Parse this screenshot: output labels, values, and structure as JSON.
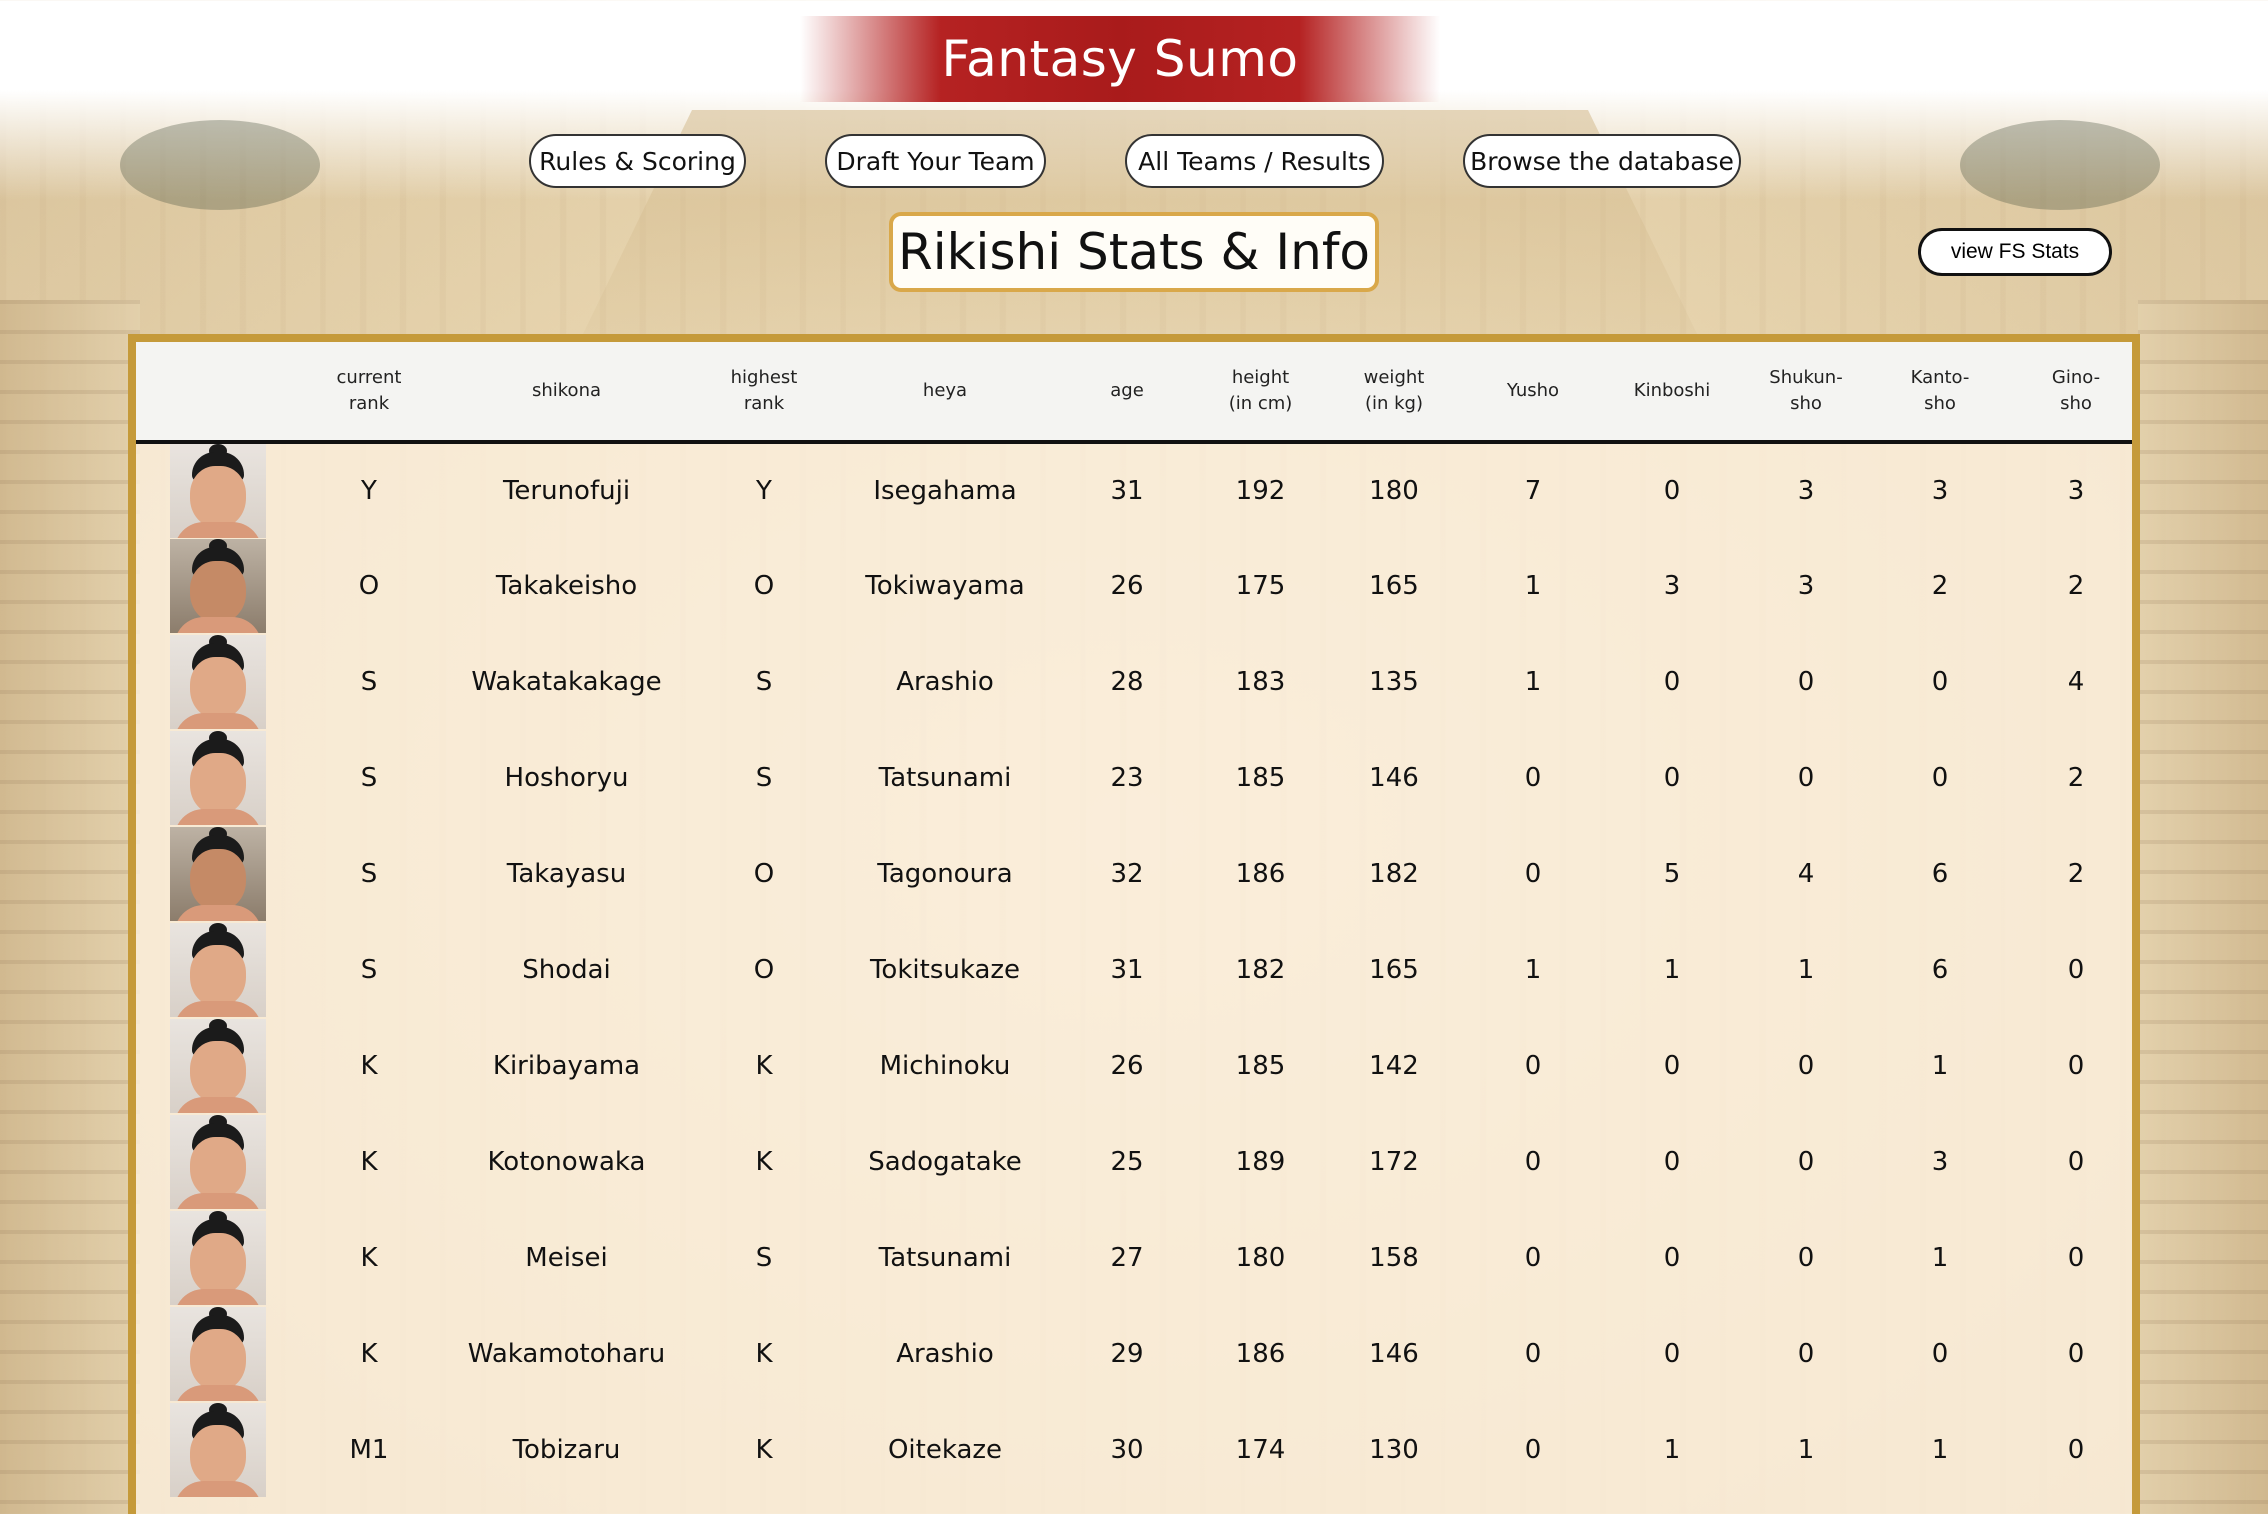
{
  "app": {
    "title": "Fantasy Sumo"
  },
  "nav": {
    "items": [
      {
        "label": "Rules & Scoring"
      },
      {
        "label": "Draft Your Team"
      },
      {
        "label": "All Teams / Results"
      },
      {
        "label": "Browse the database"
      }
    ]
  },
  "page": {
    "title": "Rikishi Stats & Info",
    "fs_stats_label": "view FS Stats"
  },
  "table": {
    "headers": [
      {
        "line1": "current",
        "line2": "rank"
      },
      {
        "line1": "shikona",
        "line2": ""
      },
      {
        "line1": "highest",
        "line2": "rank"
      },
      {
        "line1": "heya",
        "line2": ""
      },
      {
        "line1": "age",
        "line2": ""
      },
      {
        "line1": "height",
        "line2": "(in cm)"
      },
      {
        "line1": "weight",
        "line2": "(in kg)"
      },
      {
        "line1": "Yusho",
        "line2": ""
      },
      {
        "line1": "Kinboshi",
        "line2": ""
      },
      {
        "line1": "Shukun-",
        "line2": "sho"
      },
      {
        "line1": "Kanto-",
        "line2": "sho"
      },
      {
        "line1": "Gino-",
        "line2": "sho"
      }
    ],
    "rows": [
      {
        "rank": "Y",
        "shikona": "Terunofuji",
        "highest": "Y",
        "heya": "Isegahama",
        "age": "31",
        "height": "192",
        "weight": "180",
        "yusho": "7",
        "kinboshi": "0",
        "shukunsho": "3",
        "kantosho": "3",
        "ginosho": "3"
      },
      {
        "rank": "O",
        "shikona": "Takakeisho",
        "highest": "O",
        "heya": "Tokiwayama",
        "age": "26",
        "height": "175",
        "weight": "165",
        "yusho": "1",
        "kinboshi": "3",
        "shukunsho": "3",
        "kantosho": "2",
        "ginosho": "2"
      },
      {
        "rank": "S",
        "shikona": "Wakatakakage",
        "highest": "S",
        "heya": "Arashio",
        "age": "28",
        "height": "183",
        "weight": "135",
        "yusho": "1",
        "kinboshi": "0",
        "shukunsho": "0",
        "kantosho": "0",
        "ginosho": "4"
      },
      {
        "rank": "S",
        "shikona": "Hoshoryu",
        "highest": "S",
        "heya": "Tatsunami",
        "age": "23",
        "height": "185",
        "weight": "146",
        "yusho": "0",
        "kinboshi": "0",
        "shukunsho": "0",
        "kantosho": "0",
        "ginosho": "2"
      },
      {
        "rank": "S",
        "shikona": "Takayasu",
        "highest": "O",
        "heya": "Tagonoura",
        "age": "32",
        "height": "186",
        "weight": "182",
        "yusho": "0",
        "kinboshi": "5",
        "shukunsho": "4",
        "kantosho": "6",
        "ginosho": "2"
      },
      {
        "rank": "S",
        "shikona": "Shodai",
        "highest": "O",
        "heya": "Tokitsukaze",
        "age": "31",
        "height": "182",
        "weight": "165",
        "yusho": "1",
        "kinboshi": "1",
        "shukunsho": "1",
        "kantosho": "6",
        "ginosho": "0"
      },
      {
        "rank": "K",
        "shikona": "Kiribayama",
        "highest": "K",
        "heya": "Michinoku",
        "age": "26",
        "height": "185",
        "weight": "142",
        "yusho": "0",
        "kinboshi": "0",
        "shukunsho": "0",
        "kantosho": "1",
        "ginosho": "0"
      },
      {
        "rank": "K",
        "shikona": "Kotonowaka",
        "highest": "K",
        "heya": "Sadogatake",
        "age": "25",
        "height": "189",
        "weight": "172",
        "yusho": "0",
        "kinboshi": "0",
        "shukunsho": "0",
        "kantosho": "3",
        "ginosho": "0"
      },
      {
        "rank": "K",
        "shikona": "Meisei",
        "highest": "S",
        "heya": "Tatsunami",
        "age": "27",
        "height": "180",
        "weight": "158",
        "yusho": "0",
        "kinboshi": "0",
        "shukunsho": "0",
        "kantosho": "1",
        "ginosho": "0"
      },
      {
        "rank": "K",
        "shikona": "Wakamotoharu",
        "highest": "K",
        "heya": "Arashio",
        "age": "29",
        "height": "186",
        "weight": "146",
        "yusho": "0",
        "kinboshi": "0",
        "shukunsho": "0",
        "kantosho": "0",
        "ginosho": "0"
      },
      {
        "rank": "M1",
        "shikona": "Tobizaru",
        "highest": "K",
        "heya": "Oitekaze",
        "age": "30",
        "height": "174",
        "weight": "130",
        "yusho": "0",
        "kinboshi": "1",
        "shukunsho": "1",
        "kantosho": "1",
        "ginosho": "0"
      }
    ]
  },
  "colors": {
    "banner_red": "#b52222",
    "frame_gold": "#c59a3a",
    "title_border": "#d9a84a"
  }
}
